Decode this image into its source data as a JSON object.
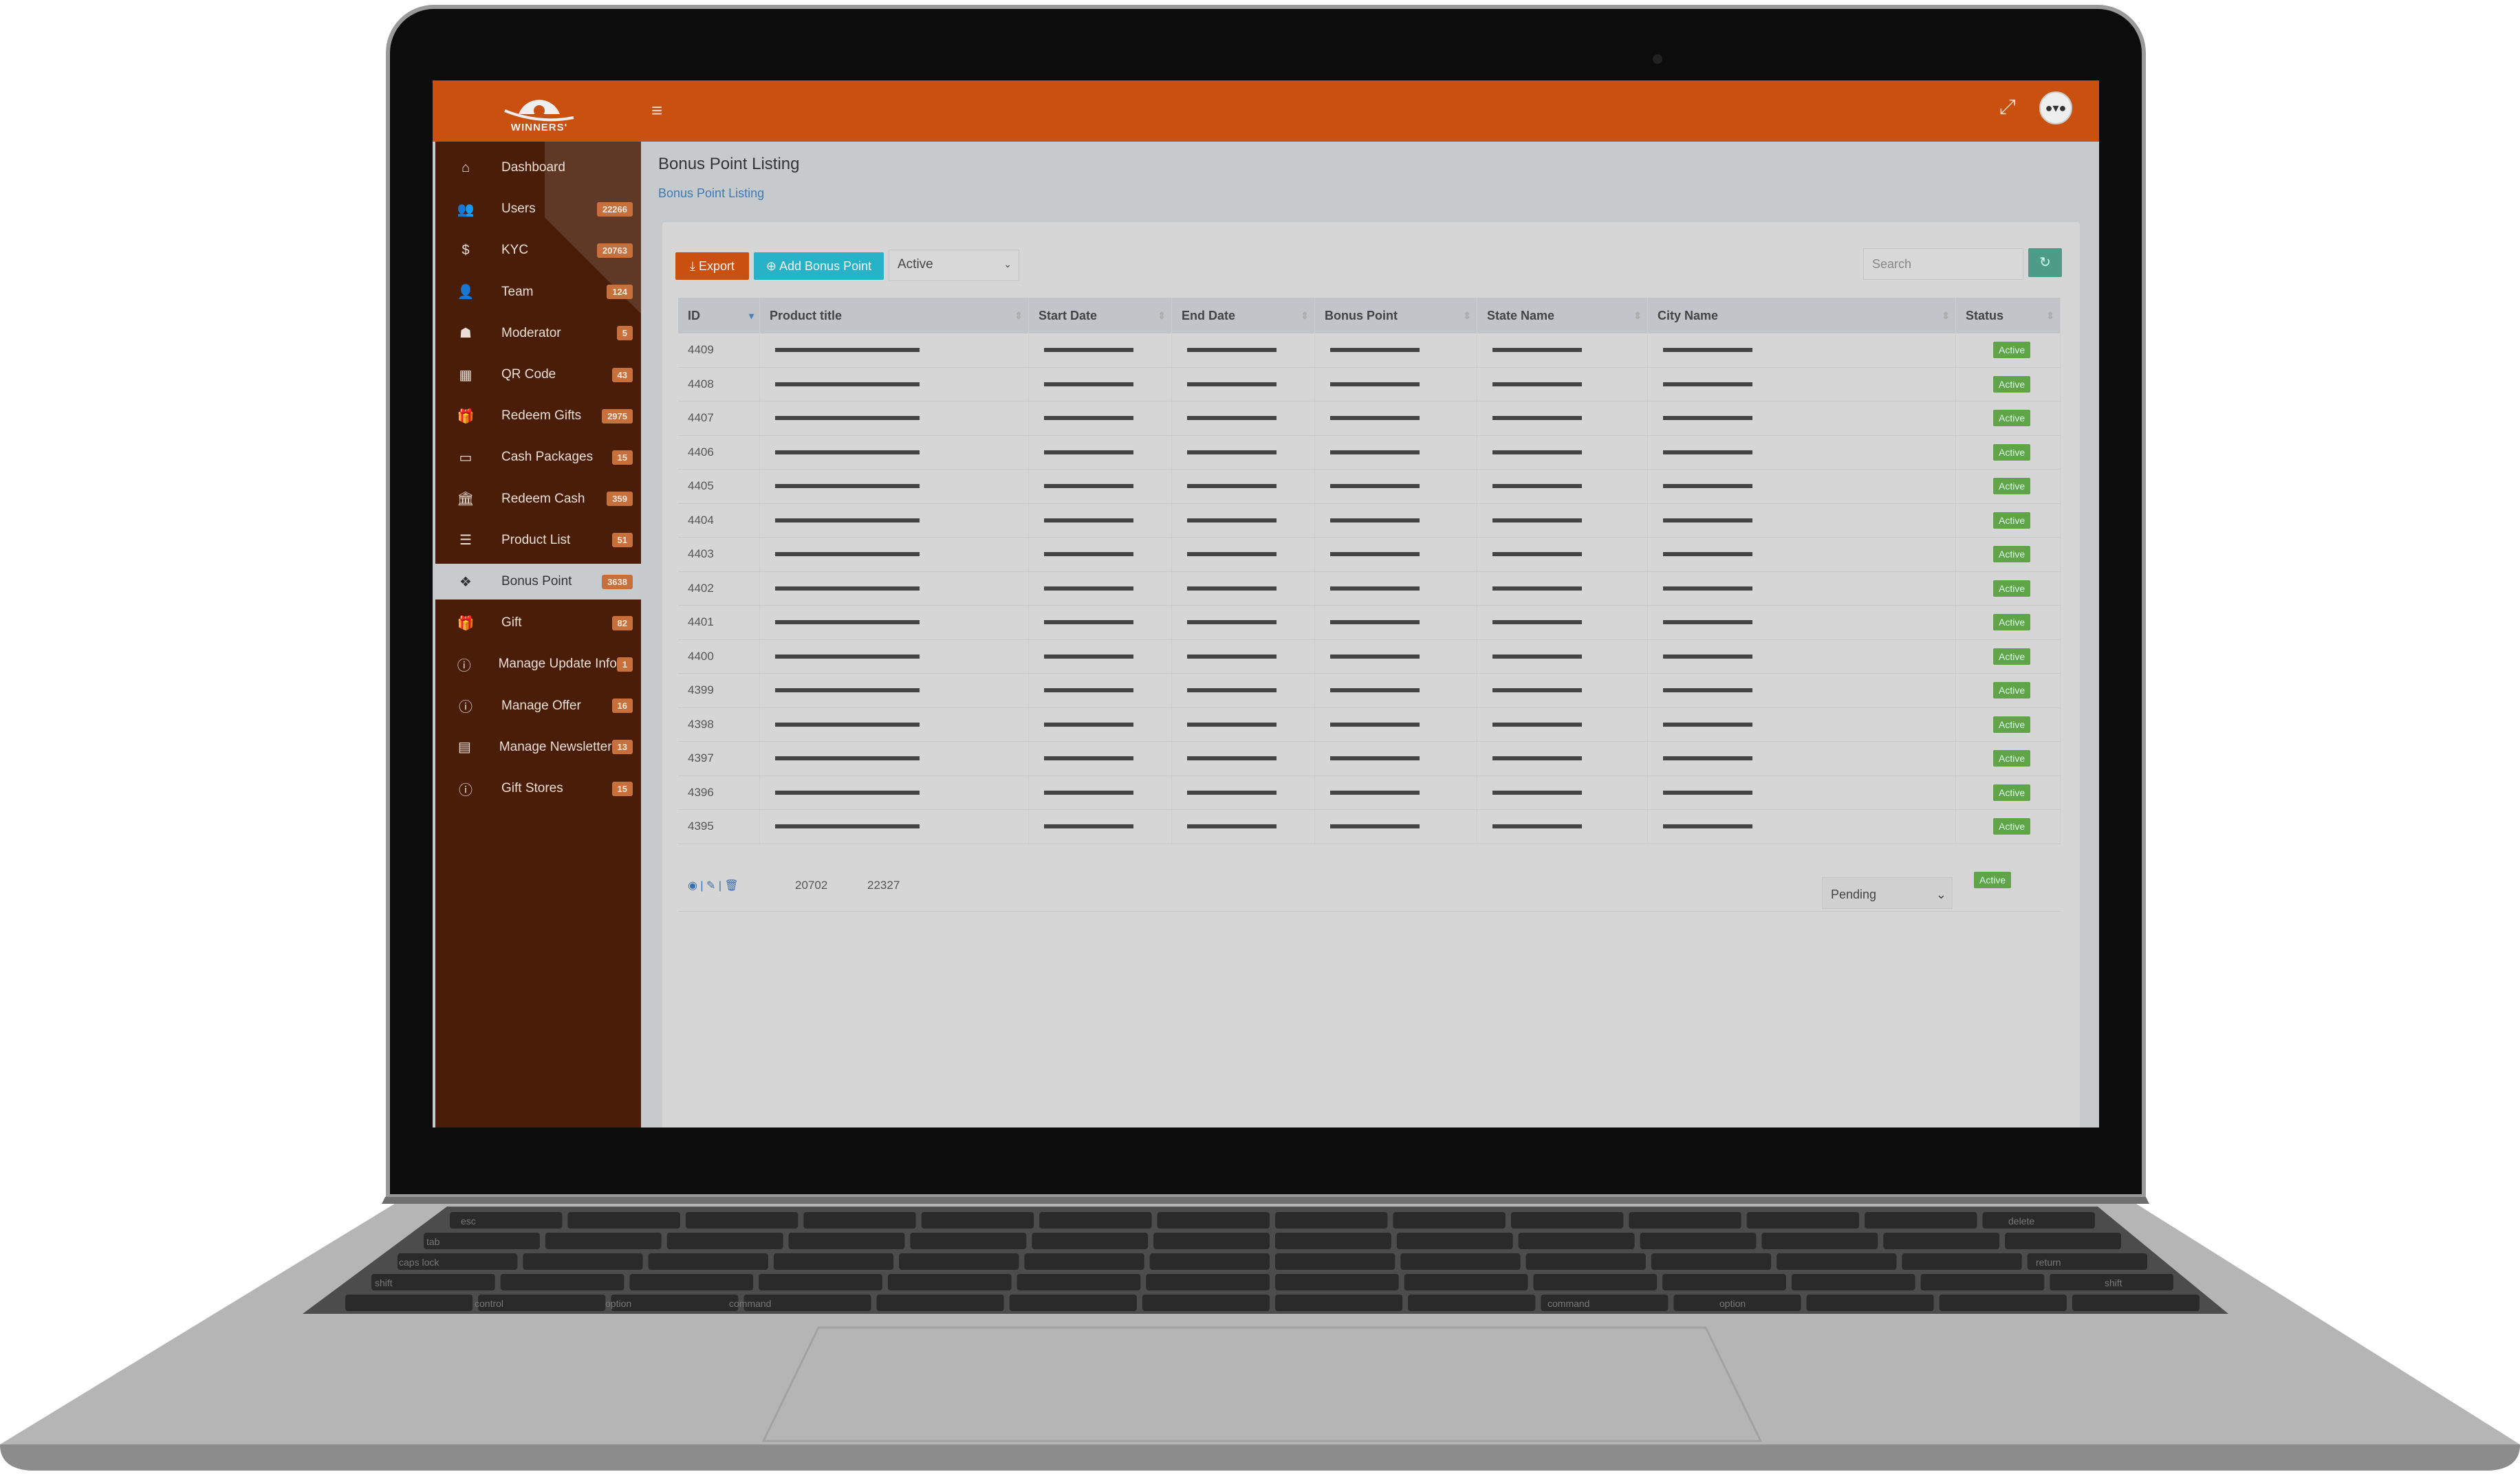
{
  "app": {
    "logo_text": "WINNERS' CIRCLE",
    "brand_color": "#c9500f",
    "sidebar_color": "#4a1d08",
    "badge_color": "#c8703c",
    "menu_icon": "hamburger-icon",
    "fullscreen_icon": "expand-icon",
    "avatar_text": "●▾●"
  },
  "sidebar": {
    "items": [
      {
        "label": "Dashboard",
        "icon": "home-icon",
        "glyph": "⌂",
        "badge": null
      },
      {
        "label": "Users",
        "icon": "users-icon",
        "glyph": "👥",
        "badge": "22266"
      },
      {
        "label": "KYC",
        "icon": "dollar-icon",
        "glyph": "$",
        "badge": "20763"
      },
      {
        "label": "Team",
        "icon": "user-plus-icon",
        "glyph": "👤",
        "badge": "124"
      },
      {
        "label": "Moderator",
        "icon": "user-secret-icon",
        "glyph": "☗",
        "badge": "5"
      },
      {
        "label": "QR Code",
        "icon": "qrcode-icon",
        "glyph": "▦",
        "badge": "43"
      },
      {
        "label": "Redeem Gifts",
        "icon": "gift-icon",
        "glyph": "🎁",
        "badge": "2975"
      },
      {
        "label": "Cash Packages",
        "icon": "money-icon",
        "glyph": "▭",
        "badge": "15"
      },
      {
        "label": "Redeem Cash",
        "icon": "bank-icon",
        "glyph": "🏛",
        "badge": "359"
      },
      {
        "label": "Product List",
        "icon": "list-icon",
        "glyph": "☰",
        "badge": "51"
      },
      {
        "label": "Bonus Point",
        "icon": "cubes-icon",
        "glyph": "❖",
        "badge": "3638",
        "active": true
      },
      {
        "label": "Gift",
        "icon": "gift-icon",
        "glyph": "🎁",
        "badge": "82"
      },
      {
        "label": "Manage Update Info",
        "icon": "info-icon",
        "glyph": "ⓘ",
        "badge": "1"
      },
      {
        "label": "Manage Offer",
        "icon": "info-icon",
        "glyph": "ⓘ",
        "badge": "16"
      },
      {
        "label": "Manage Newsletter",
        "icon": "newspaper-icon",
        "glyph": "▤",
        "badge": "13"
      },
      {
        "label": "Gift Stores",
        "icon": "info-icon",
        "glyph": "ⓘ",
        "badge": "15"
      }
    ]
  },
  "page": {
    "title": "Bonus Point Listing",
    "breadcrumb": "Bonus Point Listing"
  },
  "toolbar": {
    "export_label": "⤓ Export",
    "add_label": "⊕ Add Bonus Point",
    "status_filter": "Active",
    "search_placeholder": "Search",
    "refresh_icon": "refresh-icon"
  },
  "table": {
    "columns": [
      "ID",
      "Product title",
      "Start Date",
      "End Date",
      "Bonus Point",
      "State Name",
      "City Name",
      "Status"
    ],
    "sorted_column": "ID",
    "sort_direction": "desc",
    "rows": [
      {
        "id": "4409",
        "status": "Active"
      },
      {
        "id": "4408",
        "status": "Active"
      },
      {
        "id": "4407",
        "status": "Active"
      },
      {
        "id": "4406",
        "status": "Active"
      },
      {
        "id": "4405",
        "status": "Active"
      },
      {
        "id": "4404",
        "status": "Active"
      },
      {
        "id": "4403",
        "status": "Active"
      },
      {
        "id": "4402",
        "status": "Active"
      },
      {
        "id": "4401",
        "status": "Active"
      },
      {
        "id": "4400",
        "status": "Active"
      },
      {
        "id": "4399",
        "status": "Active"
      },
      {
        "id": "4398",
        "status": "Active"
      },
      {
        "id": "4397",
        "status": "Active"
      },
      {
        "id": "4396",
        "status": "Active"
      },
      {
        "id": "4395",
        "status": "Active"
      }
    ],
    "extra_row": {
      "col1": "20702",
      "col2": "22327",
      "select_value": "Pending",
      "status": "Active"
    }
  },
  "keyboard": {
    "labels": [
      "esc",
      "tab",
      "caps lock",
      "shift",
      "control",
      "option",
      "command",
      "command",
      "option",
      "return",
      "shift",
      "delete"
    ]
  }
}
